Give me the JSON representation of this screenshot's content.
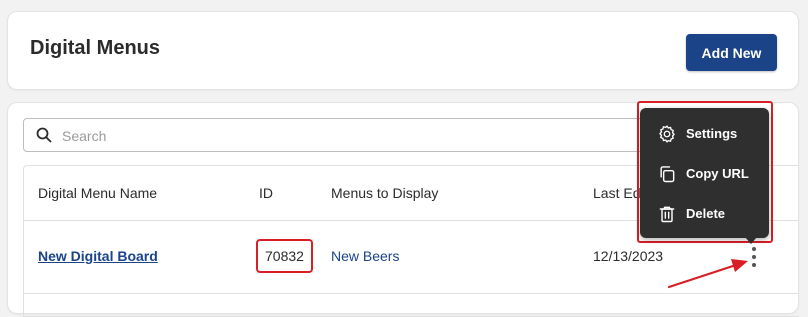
{
  "header": {
    "title": "Digital Menus",
    "add_button_label": "Add New"
  },
  "search": {
    "placeholder": "Search"
  },
  "table": {
    "columns": [
      "Digital Menu Name",
      "ID",
      "Menus to Display",
      "Last Ed"
    ],
    "rows": [
      {
        "name": "New Digital Board",
        "id": "70832",
        "menus": "New Beers",
        "last_edited": "12/13/2023"
      }
    ]
  },
  "row_menu": {
    "items": [
      {
        "label": "Settings",
        "icon": "gear-icon"
      },
      {
        "label": "Copy URL",
        "icon": "copy-icon"
      },
      {
        "label": "Delete",
        "icon": "trash-icon"
      }
    ]
  },
  "colors": {
    "primary": "#1a4388",
    "highlight": "#d81f26",
    "menu_bg": "#2f2f2f"
  }
}
